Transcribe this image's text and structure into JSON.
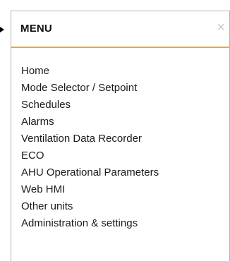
{
  "menu": {
    "title": "MENU",
    "close_glyph": "×",
    "items": [
      {
        "label": "Home"
      },
      {
        "label": "Mode Selector / Setpoint"
      },
      {
        "label": "Schedules"
      },
      {
        "label": "Alarms"
      },
      {
        "label": "Ventilation Data Recorder"
      },
      {
        "label": "ECO"
      },
      {
        "label": "AHU Operational Parameters"
      },
      {
        "label": "Web HMI"
      },
      {
        "label": "Other units"
      },
      {
        "label": "Administration & settings"
      }
    ]
  },
  "colors": {
    "accent": "#f2a531",
    "border": "#b4b4b4",
    "text": "#1a1a1a",
    "close": "#c8c8c8"
  },
  "icons": {
    "close": "close-icon",
    "pointer": "pointer-arrow-icon"
  }
}
